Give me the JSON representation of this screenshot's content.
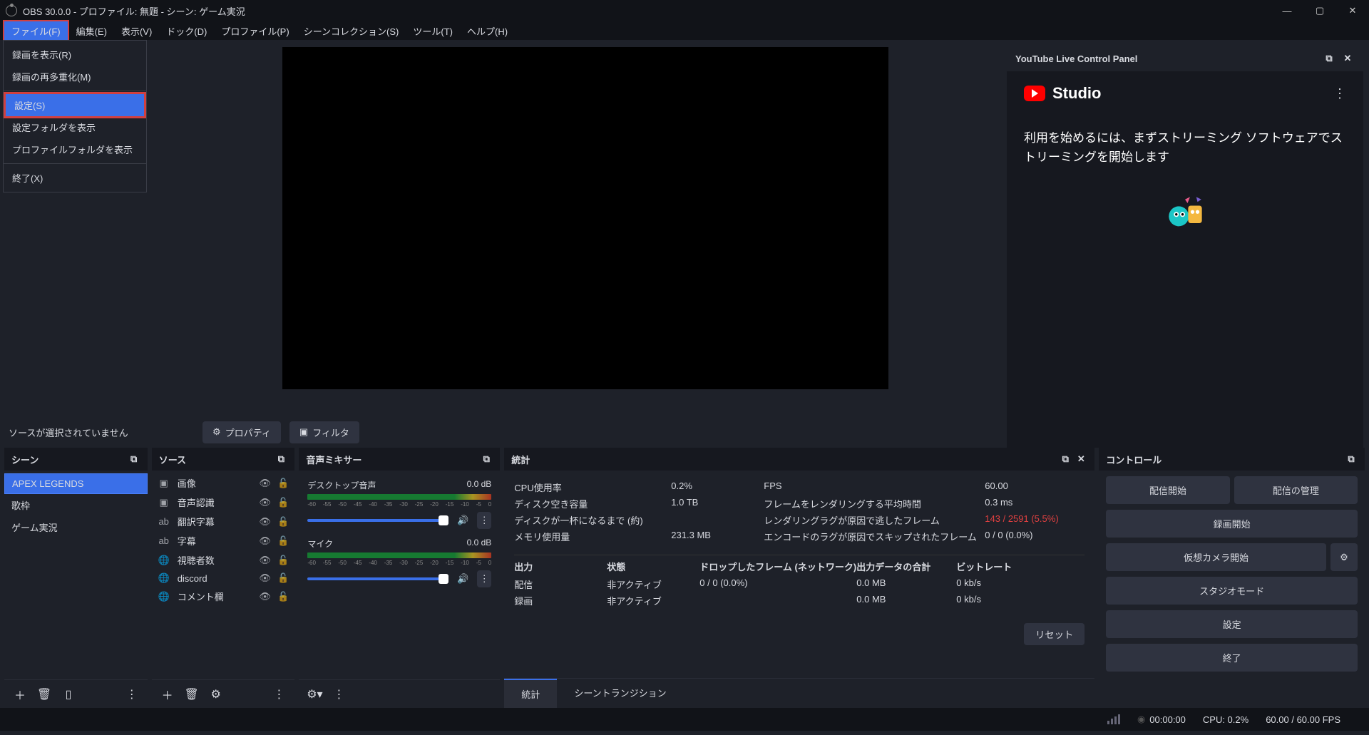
{
  "titlebar": {
    "title": "OBS 30.0.0 - プロファイル: 無題 - シーン: ゲーム実況"
  },
  "menubar": [
    {
      "label": "ファイル(F)",
      "key": "file",
      "hl": true
    },
    {
      "label": "編集(E)",
      "key": "edit"
    },
    {
      "label": "表示(V)",
      "key": "view"
    },
    {
      "label": "ドック(D)",
      "key": "dock"
    },
    {
      "label": "プロファイル(P)",
      "key": "profile"
    },
    {
      "label": "シーンコレクション(S)",
      "key": "scenecol"
    },
    {
      "label": "ツール(T)",
      "key": "tools"
    },
    {
      "label": "ヘルプ(H)",
      "key": "help"
    }
  ],
  "file_menu": {
    "items": [
      {
        "label": "録画を表示(R)",
        "key": "show-rec"
      },
      {
        "label": "録画の再多重化(M)",
        "key": "remux"
      },
      {
        "sep": true
      },
      {
        "label": "設定(S)",
        "key": "settings",
        "hl": true
      },
      {
        "label": "設定フォルダを表示",
        "key": "show-settings-folder"
      },
      {
        "label": "プロファイルフォルダを表示",
        "key": "show-profile-folder"
      },
      {
        "sep": true
      },
      {
        "label": "終了(X)",
        "key": "exit"
      }
    ]
  },
  "preview_toolbar": {
    "status": "ソースが選択されていません",
    "properties": "プロパティ",
    "filters": "フィルタ"
  },
  "yt": {
    "header": "YouTube Live Control Panel",
    "studio": "Studio",
    "message": "利用を始めるには、まずストリーミング ソフトウェアでストリーミングを開始します"
  },
  "scenes": {
    "title": "シーン",
    "items": [
      "APEX LEGENDS",
      "歌枠",
      "ゲーム実況"
    ],
    "selected": 0
  },
  "sources": {
    "title": "ソース",
    "items": [
      {
        "icon": "img",
        "label": "画像"
      },
      {
        "icon": "img",
        "label": "音声認識"
      },
      {
        "icon": "ab",
        "label": "翻訳字幕"
      },
      {
        "icon": "ab",
        "label": "字幕"
      },
      {
        "icon": "globe",
        "label": "視聴者数"
      },
      {
        "icon": "globe",
        "label": "discord"
      },
      {
        "icon": "globe",
        "label": "コメント欄"
      }
    ]
  },
  "mixer": {
    "title": "音声ミキサー",
    "channels": [
      {
        "name": "デスクトップ音声",
        "level": "0.0 dB"
      },
      {
        "name": "マイク",
        "level": "0.0 dB"
      }
    ],
    "scale": [
      "-60",
      "-55",
      "-50",
      "-45",
      "-40",
      "-35",
      "-30",
      "-25",
      "-20",
      "-15",
      "-10",
      "-5",
      "0"
    ]
  },
  "stats": {
    "title": "統計",
    "rows": [
      [
        "CPU使用率",
        "0.2%",
        "FPS",
        "60.00"
      ],
      [
        "ディスク空き容量",
        "1.0 TB",
        "フレームをレンダリングする平均時間",
        "0.3 ms"
      ],
      [
        "ディスクが一杯になるまで (約)",
        "",
        "レンダリングラグが原因で逃したフレーム",
        "143 / 2591 (5.5%)"
      ],
      [
        "メモリ使用量",
        "231.3 MB",
        "エンコードのラグが原因でスキップされたフレーム",
        "0 / 0 (0.0%)"
      ]
    ],
    "table_head": [
      "出力",
      "状態",
      "ドロップしたフレーム (ネットワーク)",
      "出力データの合計",
      "ビットレート"
    ],
    "table_rows": [
      [
        "配信",
        "非アクティブ",
        "0 / 0 (0.0%)",
        "0.0 MB",
        "0 kb/s"
      ],
      [
        "録画",
        "非アクティブ",
        "",
        "0.0 MB",
        "0 kb/s"
      ]
    ],
    "reset": "リセット",
    "tabs": [
      "統計",
      "シーントランジション"
    ],
    "active_tab": 0
  },
  "controls": {
    "title": "コントロール",
    "start_stream": "配信開始",
    "manage_stream": "配信の管理",
    "start_record": "録画開始",
    "virtual_cam": "仮想カメラ開始",
    "studio_mode": "スタジオモード",
    "settings": "設定",
    "exit": "終了"
  },
  "statusbar": {
    "rec_time": "00:00:00",
    "cpu": "CPU: 0.2%",
    "fps": "60.00 / 60.00 FPS"
  }
}
